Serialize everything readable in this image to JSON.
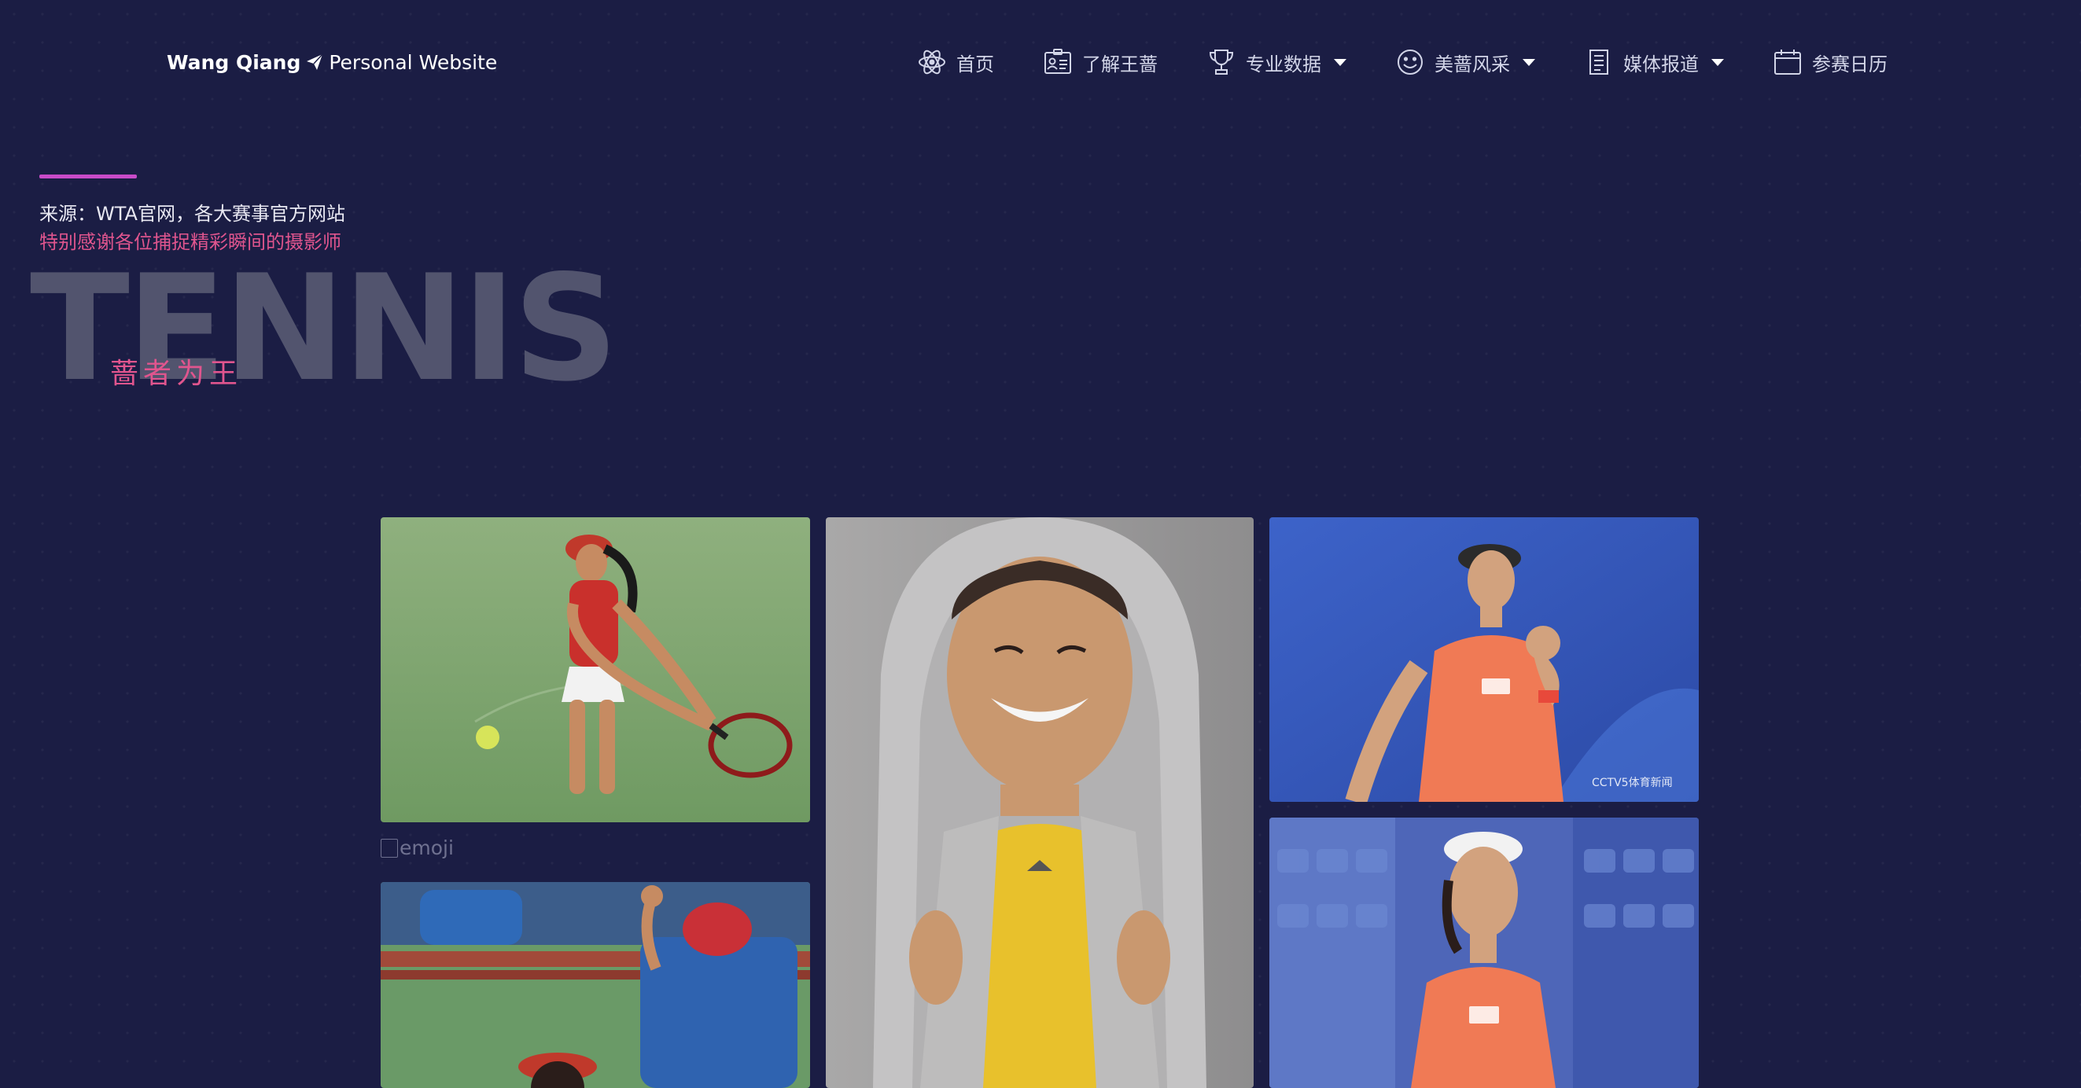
{
  "brand": {
    "name": "Wang Qiang",
    "suffix": "Personal Website"
  },
  "nav": {
    "items": [
      {
        "label": "首页",
        "icon": "atom-icon",
        "dropdown": false
      },
      {
        "label": "了解王蔷",
        "icon": "id-card-icon",
        "dropdown": false
      },
      {
        "label": "专业数据",
        "icon": "trophy-icon",
        "dropdown": true
      },
      {
        "label": "美蔷风采",
        "icon": "smile-icon",
        "dropdown": true
      },
      {
        "label": "媒体报道",
        "icon": "document-icon",
        "dropdown": true
      },
      {
        "label": "参赛日历",
        "icon": "calendar-icon",
        "dropdown": false
      }
    ]
  },
  "hero": {
    "source": "来源：WTA官网，各大赛事官方网站",
    "thanks": "特别感谢各位捕捉精彩瞬间的摄影师",
    "big_title": "TENNIS",
    "slogan": "蔷者为王"
  },
  "gallery": {
    "broken_image_alt": "emoji",
    "watermarks": {
      "photo_3": "CCTV5体育新闻"
    }
  },
  "colors": {
    "background": "#1b1d44",
    "accent_pink": "#e0558e",
    "accent_line": "#c84bc9",
    "title_gray": "#52546e"
  }
}
